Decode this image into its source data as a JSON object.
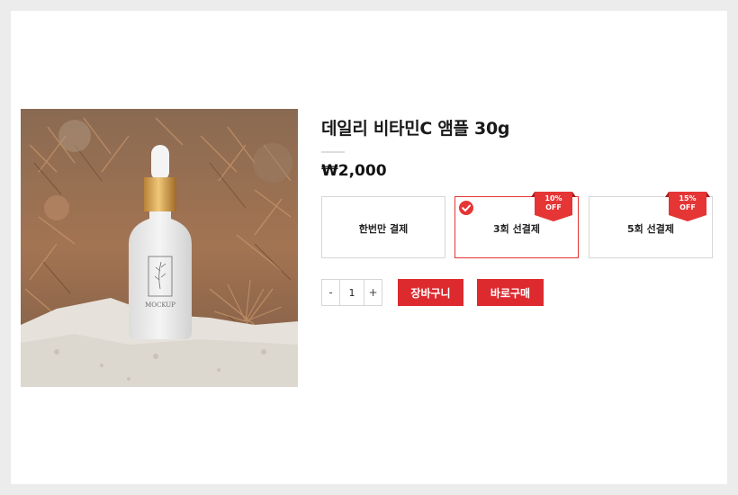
{
  "product": {
    "title": "데일리 비타민C 앰플 30g",
    "price": "₩2,000",
    "image_label": "MOCKUP"
  },
  "options": [
    {
      "label": "한번만 결제",
      "badge": "",
      "selected": false
    },
    {
      "label": "3회 선결제",
      "badge": "10%\nOFF",
      "badge_line1": "10%",
      "badge_line2": "OFF",
      "selected": true
    },
    {
      "label": "5회 선결제",
      "badge": "15%\nOFF",
      "badge_line1": "15%",
      "badge_line2": "OFF",
      "selected": false
    }
  ],
  "quantity": {
    "minus": "-",
    "value": "1",
    "plus": "+"
  },
  "buttons": {
    "cart": "장바구니",
    "buy": "바로구매"
  },
  "colors": {
    "accent": "#dd2a2f",
    "selected_border": "#e53535",
    "background": "#ececec"
  },
  "icons": {
    "check": "check-circle-icon",
    "ribbon": "discount-ribbon-icon"
  }
}
